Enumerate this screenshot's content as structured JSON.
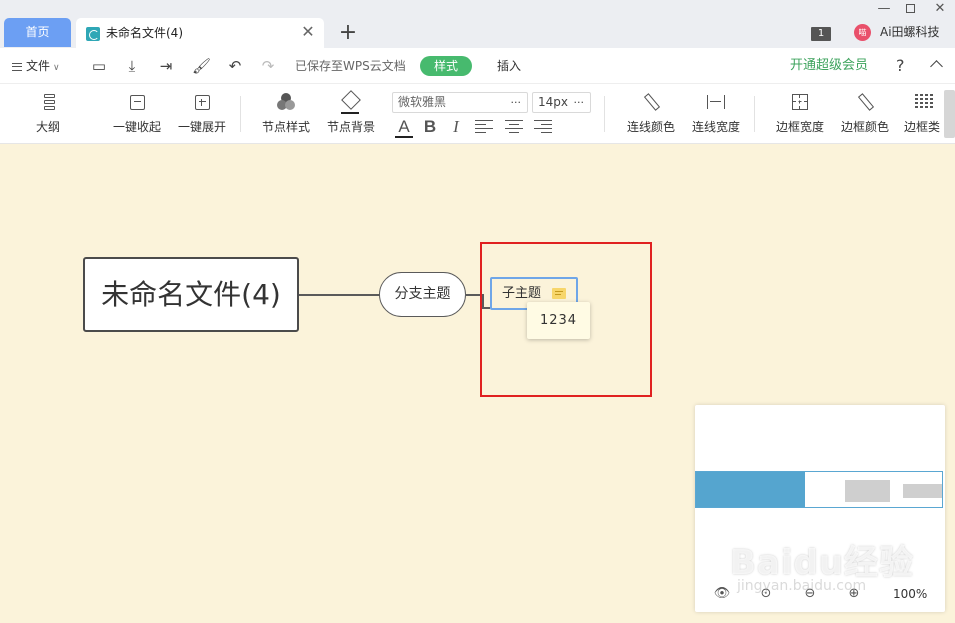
{
  "tabs": {
    "home": "首页",
    "doc": "未命名文件(4)",
    "close": "✕",
    "add": "+"
  },
  "window": {
    "badge": "1",
    "avatar": "喵",
    "user": "Ai田螺科技"
  },
  "menu": {
    "file": "文件",
    "save_status": "已保存至WPS云文档",
    "style_tab": "样式",
    "insert_tab": "插入",
    "vip": "开通超级会员",
    "help": "?"
  },
  "toolbar": {
    "outline": "大纲",
    "collapse_all": "一键收起",
    "expand_all": "一键展开",
    "node_style": "节点样式",
    "node_bg": "节点背景",
    "font_family": "微软雅黑",
    "font_size": "14px",
    "more": "···",
    "bold": "B",
    "italic": "I",
    "font_color": "A",
    "line_color": "连线颜色",
    "line_width": "连线宽度",
    "border_width": "边框宽度",
    "border_color": "边框颜色",
    "border_type": "边框类"
  },
  "mindmap": {
    "root": "未命名文件(4)",
    "branch": "分支主题",
    "child": "子主题",
    "note": "1234"
  },
  "minimap": {
    "zoom": "100%"
  },
  "watermark": {
    "main": "Baidu经验",
    "sub": "jingyan.baidu.com"
  },
  "colors": {
    "canvas_bg": "#fbf3da",
    "accent_green": "#47ba6e",
    "tab_blue": "#6c9ff3",
    "highlight_red": "#e02020",
    "selection_blue": "#6fa6e8"
  }
}
